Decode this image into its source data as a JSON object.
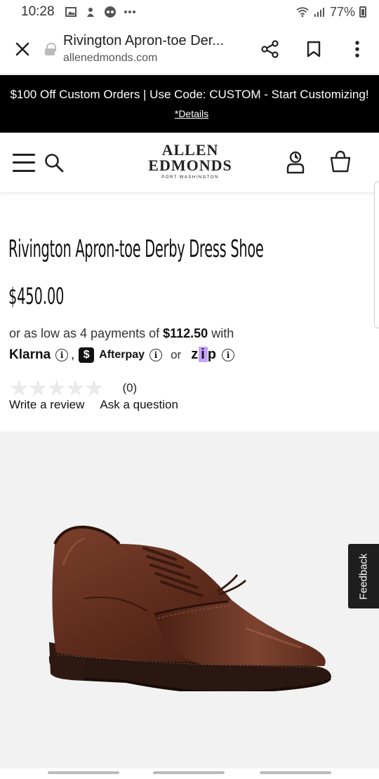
{
  "status_bar": {
    "time": "10:28",
    "battery": "77%",
    "icons": [
      "image-icon",
      "notification-icon",
      "app-icon",
      "more-icon",
      "wifi-icon",
      "signal-icon",
      "battery-icon"
    ]
  },
  "browser": {
    "tab_title": "Rivington Apron-toe Der...",
    "domain": "allenedmonds.com",
    "icons": [
      "close-icon",
      "lock-icon",
      "share-icon",
      "bookmark-icon",
      "more-vert-icon"
    ]
  },
  "promo": {
    "text": "$100 Off Custom Orders | Use Code: CUSTOM - Start Customizing!",
    "link": "*Details"
  },
  "header": {
    "logo_line1": "ALLEN",
    "logo_line2": "EDMONDS",
    "logo_sub": "PORT WASHINGTON"
  },
  "product": {
    "name": "Rivington Apron-toe Derby Dress Shoe",
    "price": "$450.00",
    "installments_prefix": "or as low as 4 payments of",
    "installments_amount": "$112.50",
    "installments_suffix": "with",
    "klarna": "Klarna",
    "afterpay": "Afterpay",
    "afterpay_badge": "$",
    "or": "or",
    "zip_z": "z",
    "zip_i": "i",
    "zip_p": "p",
    "info_glyph": "i",
    "comma": ",",
    "rating_stars": 0,
    "review_count": "(0)",
    "write_review": "Write a review",
    "ask_question": "Ask a question"
  },
  "feedback_tab": "Feedback",
  "colors": {
    "promo_bg": "#000000",
    "image_bg": "#f2f2f2",
    "zip_accent": "#c5a3ff",
    "shoe_leather": "#6b3424"
  }
}
